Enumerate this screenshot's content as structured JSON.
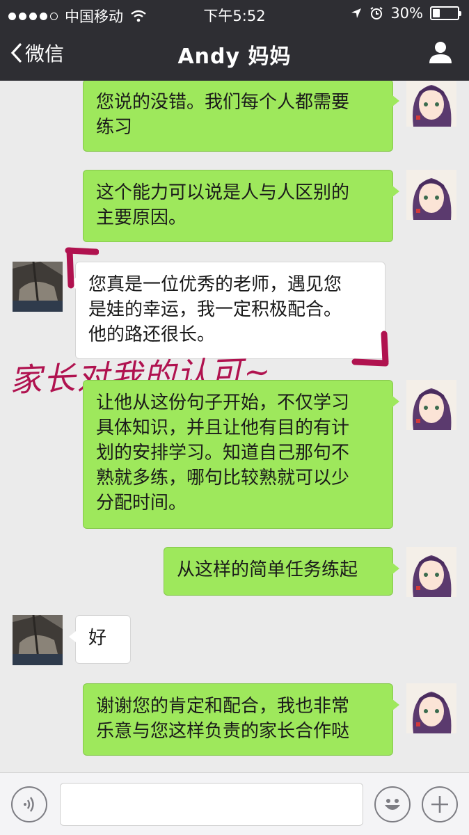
{
  "status_bar": {
    "carrier": "中国移动",
    "time": "下午5:52",
    "battery_percent": "30%",
    "battery_level": 0.3,
    "signal_icons": [
      "signal-dots-icon",
      "wifi-icon",
      "location-arrow-icon",
      "alarm-clock-icon",
      "battery-icon"
    ]
  },
  "nav": {
    "back_label": "微信",
    "title": "Andy 妈妈",
    "profile_icon": "person-icon"
  },
  "messages": [
    {
      "side": "out",
      "text": "您说的没错。我们每个人都需要\n练习"
    },
    {
      "side": "out",
      "text": "这个能力可以说是人与人区别的\n主要原因。"
    },
    {
      "side": "in",
      "text": "您真是一位优秀的老师，遇见您\n是娃的幸运，我一定积极配合。\n他的路还很长。"
    },
    {
      "side": "out",
      "text": "让他从这份句子开始，不仅学习\n具体知识，并且让他有目的有计\n划的安排学习。知道自己那句不\n熟就多练，哪句比较熟就可以少\n分配时间。"
    },
    {
      "side": "out",
      "text": "从这样的简单任务练起"
    },
    {
      "side": "in",
      "text": "好"
    },
    {
      "side": "out",
      "text": "谢谢您的肯定和配合，我也非常\n乐意与您这样负责的家长合作哒"
    }
  ],
  "annotation": {
    "text": "家长对我的认可~",
    "color": "#b0124f"
  },
  "input_bar": {
    "voice_icon": "voice-icon",
    "emoji_icon": "emoji-icon",
    "plus_icon": "plus-icon"
  },
  "colors": {
    "nav_bg": "#2e2e33",
    "chat_bg": "#ebebeb",
    "outgoing_bubble": "#9ee85c",
    "incoming_bubble": "#ffffff"
  }
}
